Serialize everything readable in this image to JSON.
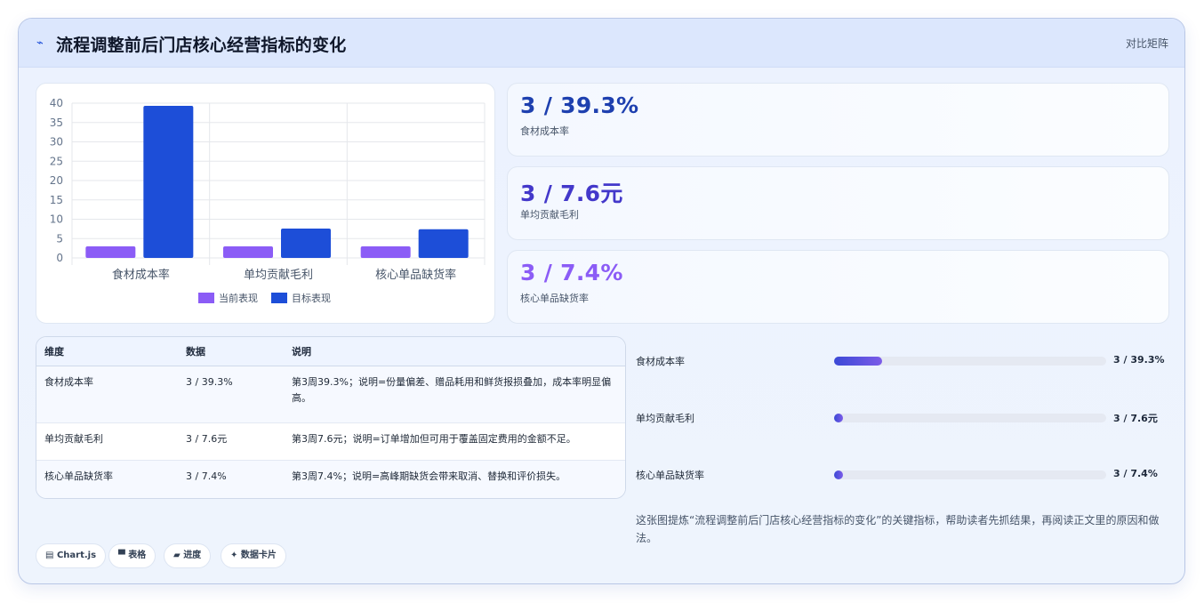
{
  "header": {
    "icon": "trend-icon",
    "title": "流程调整前后门店核心经营指标的变化",
    "tag": "对比矩阵"
  },
  "colors": {
    "current": "#8b5cf6",
    "target": "#1d4ed8",
    "stat_blue": "#1e40af",
    "stat_indigo": "#4338ca",
    "stat_purple": "#8b5cf6"
  },
  "chart_data": {
    "type": "bar",
    "categories": [
      "食材成本率",
      "单均贡献毛利",
      "核心单品缺货率"
    ],
    "series": [
      {
        "name": "当前表现",
        "values": [
          3,
          3,
          3
        ]
      },
      {
        "name": "目标表现",
        "values": [
          39.3,
          7.6,
          7.4
        ]
      }
    ],
    "ylim": [
      0,
      40
    ],
    "yticks": [
      "0",
      "5",
      "10",
      "15",
      "20",
      "25",
      "30",
      "35",
      "40"
    ],
    "grid": true,
    "legend": "bottom"
  },
  "stats": [
    {
      "value": "3 / 39.3%",
      "label": "食材成本率"
    },
    {
      "value": "3 / 7.6元",
      "label": "单均贡献毛利"
    },
    {
      "value": "3 / 7.4%",
      "label": "核心单品缺货率"
    }
  ],
  "table": {
    "headers": [
      "维度",
      "数据",
      "说明"
    ],
    "rows": [
      [
        "食材成本率",
        "3 / 39.3%",
        "第3周39.3%；说明=份量偏差、赠品耗用和鲜货报损叠加，成本率明显偏高。"
      ],
      [
        "单均贡献毛利",
        "3 / 7.6元",
        "第3周7.6元；说明=订单增加但可用于覆盖固定费用的金额不足。"
      ],
      [
        "核心单品缺货率",
        "3 / 7.4%",
        "第3周7.4%；说明=高峰期缺货会带来取消、替换和评价损失。"
      ]
    ]
  },
  "progress": [
    {
      "label": "食材成本率",
      "value": "3 / 39.3%",
      "fraction": 0.176
    },
    {
      "label": "单均贡献毛利",
      "value": "3 / 7.6元",
      "fraction": 0.02
    },
    {
      "label": "核心单品缺货率",
      "value": "3 / 7.4%",
      "fraction": 0.02
    }
  ],
  "description": "这张图提炼“流程调整前后门店核心经营指标的变化”的关键指标，帮助读者先抓结果，再阅读正文里的原因和做法。",
  "chips": [
    {
      "icon": "chart-icon",
      "glyph": "▤",
      "label": "Chart.js"
    },
    {
      "icon": "table-icon",
      "glyph": "▀",
      "label": "表格"
    },
    {
      "icon": "progress-icon",
      "glyph": "▰",
      "label": "进度"
    },
    {
      "icon": "sparkle-icon",
      "glyph": "✦",
      "label": "数据卡片"
    }
  ]
}
